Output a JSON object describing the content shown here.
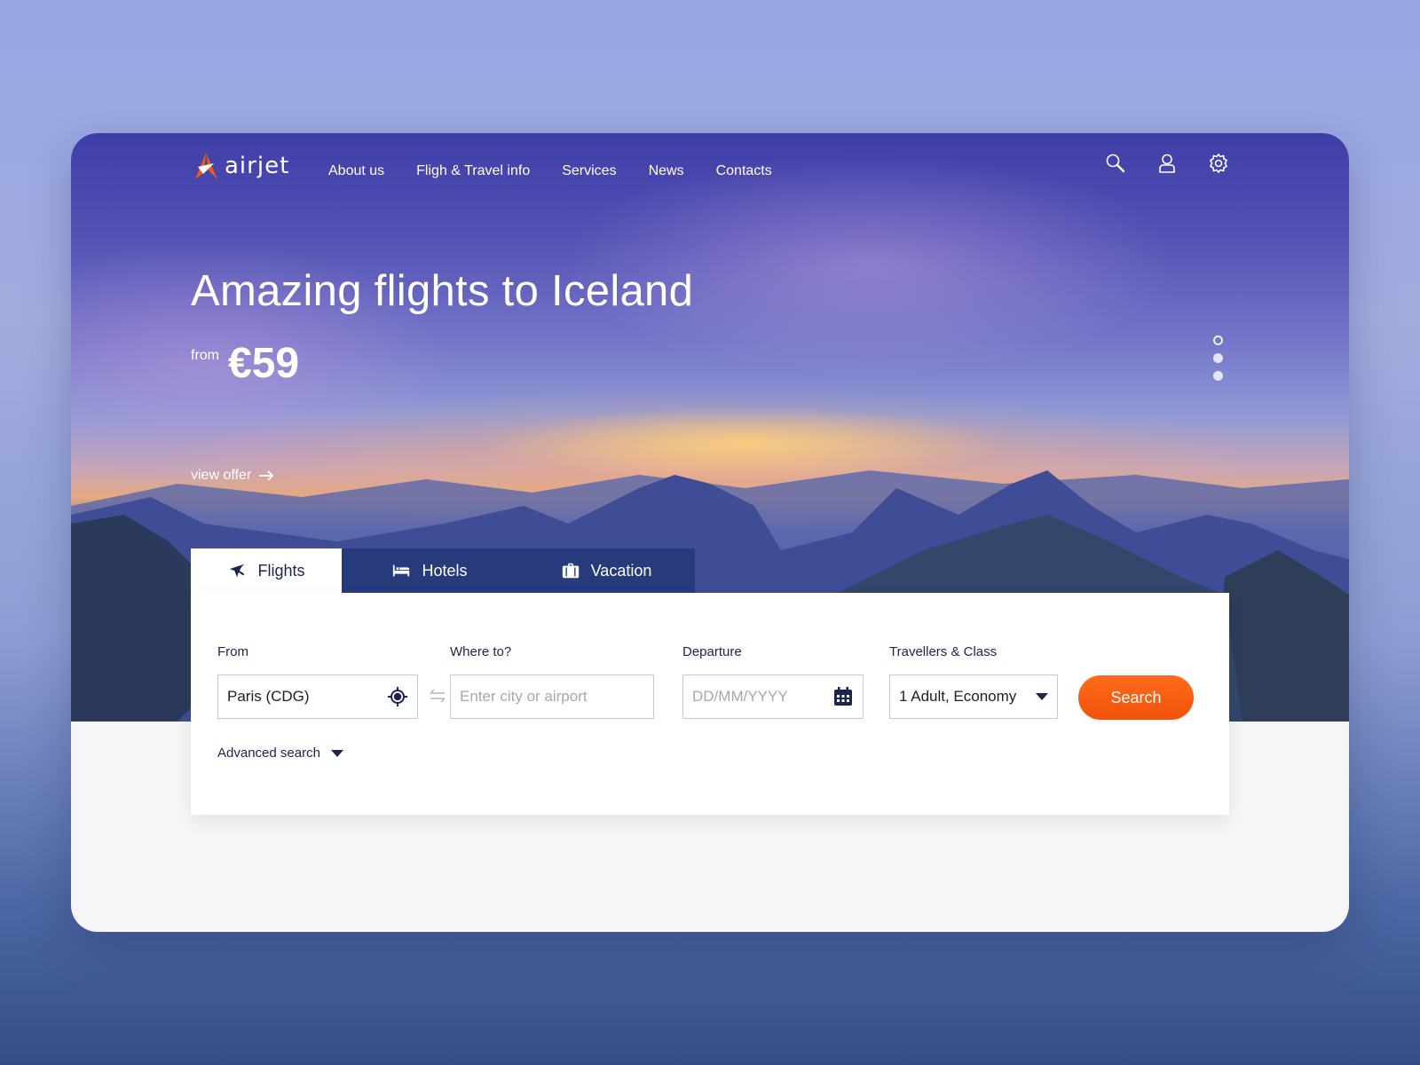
{
  "brand": {
    "name": "airjet",
    "accent": "#f05a12",
    "primary_dark": "#1a2550"
  },
  "nav": {
    "links": [
      "About us",
      "Fligh & Travel info",
      "Services",
      "News",
      "Contacts"
    ],
    "icons": [
      "search-icon",
      "user-icon",
      "gear-icon"
    ]
  },
  "hero": {
    "title": "Amazing flights to Iceland",
    "price_prefix": "from",
    "price": "€59",
    "cta": "view offer",
    "slides": {
      "total": 3,
      "active": 1
    }
  },
  "tabs": [
    {
      "label": "Flights",
      "icon": "plane-icon",
      "active": true
    },
    {
      "label": "Hotels",
      "icon": "bed-icon",
      "active": false
    },
    {
      "label": "Vacation",
      "icon": "suitcase-icon",
      "active": false
    }
  ],
  "search": {
    "from": {
      "label": "From",
      "value": "Paris (CDG)",
      "icon": "location-target-icon"
    },
    "to": {
      "label": "Where to?",
      "value": "",
      "placeholder": "Enter city or airport"
    },
    "departure": {
      "label": "Departure",
      "value": "",
      "placeholder": "DD/MM/YYYY",
      "icon": "calendar-icon"
    },
    "travellers": {
      "label": "Travellers & Class",
      "value": "1 Adult, Economy"
    },
    "button": "Search",
    "advanced": "Advanced search"
  }
}
